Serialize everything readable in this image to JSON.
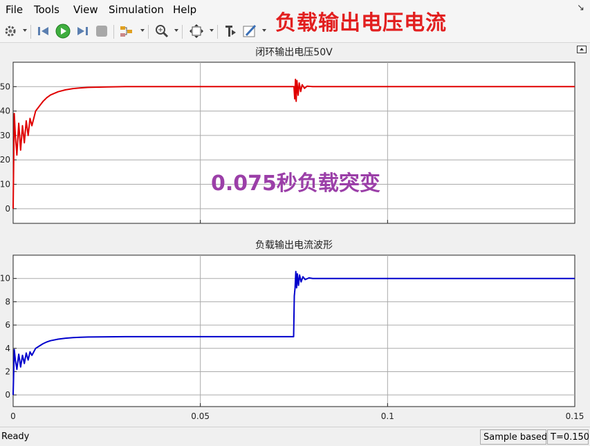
{
  "menu": {
    "items": [
      "File",
      "Tools",
      "View",
      "Simulation",
      "Help"
    ]
  },
  "toolbar": {
    "icons": [
      "gear-icon",
      "step-back-icon",
      "run-icon",
      "step-forward-icon",
      "stop-icon",
      "signal-select-icon",
      "zoom-icon",
      "fit-axes-icon",
      "cursor-measure-icon",
      "style-pen-icon"
    ]
  },
  "overlay": {
    "headline": "负载输出电压电流",
    "annotation": "0.075秒负载突变"
  },
  "colors": {
    "voltage": "#e00000",
    "current": "#0000cc",
    "headline": "#e21f1f",
    "annotation": "#9b3fa8"
  },
  "status": {
    "ready": "Ready",
    "mode": "Sample based",
    "time": "T=0.150"
  },
  "chart_data": [
    {
      "type": "line",
      "title": "闭环输出电压50V",
      "xlim": [
        0,
        0.15
      ],
      "ylim": [
        -6,
        60
      ],
      "yticks": [
        0,
        10,
        20,
        30,
        40,
        50
      ],
      "xticks": [
        0,
        0.05,
        0.1,
        0.15
      ],
      "grid": true,
      "series": [
        {
          "x": [
            0,
            0.0003,
            0.0006,
            0.001,
            0.0015,
            0.002,
            0.0025,
            0.003,
            0.0035,
            0.004,
            0.0045,
            0.005,
            0.006,
            0.007,
            0.008,
            0.009,
            0.01,
            0.012,
            0.014,
            0.016,
            0.018,
            0.02,
            0.025,
            0.03,
            0.04,
            0.05,
            0.06,
            0.07,
            0.0745,
            0.075,
            0.0752,
            0.0754,
            0.0756,
            0.0758,
            0.0761,
            0.0764,
            0.0768,
            0.0772,
            0.0778,
            0.0785,
            0.08,
            0.09,
            0.1,
            0.11,
            0.12,
            0.13,
            0.14,
            0.15
          ],
          "y": [
            0,
            39,
            30,
            22,
            35,
            24,
            34,
            27,
            36,
            30,
            37,
            34,
            40,
            42,
            44,
            45.5,
            46.6,
            47.9,
            48.7,
            49.2,
            49.5,
            49.7,
            49.9,
            50,
            50,
            50,
            50,
            50,
            50,
            50,
            45,
            53,
            44,
            52.5,
            46.5,
            51.5,
            48,
            50.8,
            49.3,
            50.2,
            50,
            50,
            50,
            50,
            50,
            50,
            50,
            50
          ]
        }
      ]
    },
    {
      "type": "line",
      "title": "负载输出电流波形",
      "xlim": [
        0,
        0.15
      ],
      "ylim": [
        -1,
        12
      ],
      "yticks": [
        0,
        2,
        4,
        6,
        8,
        10
      ],
      "xticks": [
        0,
        0.05,
        0.1,
        0.15
      ],
      "xticklabels": [
        "0",
        "0.05",
        "0.1",
        "0.15"
      ],
      "grid": true,
      "series": [
        {
          "x": [
            0,
            0.0003,
            0.0006,
            0.001,
            0.0015,
            0.002,
            0.0025,
            0.003,
            0.0035,
            0.004,
            0.0045,
            0.005,
            0.006,
            0.007,
            0.008,
            0.009,
            0.01,
            0.012,
            0.014,
            0.016,
            0.018,
            0.02,
            0.025,
            0.03,
            0.04,
            0.05,
            0.06,
            0.07,
            0.0749,
            0.0751,
            0.0753,
            0.0755,
            0.0757,
            0.0759,
            0.0762,
            0.0765,
            0.0769,
            0.0774,
            0.078,
            0.079,
            0.08,
            0.09,
            0.1,
            0.11,
            0.12,
            0.13,
            0.14,
            0.15
          ],
          "y": [
            0,
            3.9,
            3.0,
            2.2,
            3.5,
            2.4,
            3.4,
            2.7,
            3.6,
            3.0,
            3.7,
            3.4,
            4.0,
            4.2,
            4.4,
            4.55,
            4.66,
            4.79,
            4.87,
            4.92,
            4.95,
            4.97,
            4.99,
            5,
            5,
            5,
            5,
            5,
            5,
            8.5,
            9.2,
            10.6,
            9.2,
            10.4,
            9.4,
            10.3,
            9.7,
            10.15,
            9.9,
            10.05,
            10,
            10,
            10,
            10,
            10,
            10,
            10,
            10
          ]
        }
      ]
    }
  ]
}
